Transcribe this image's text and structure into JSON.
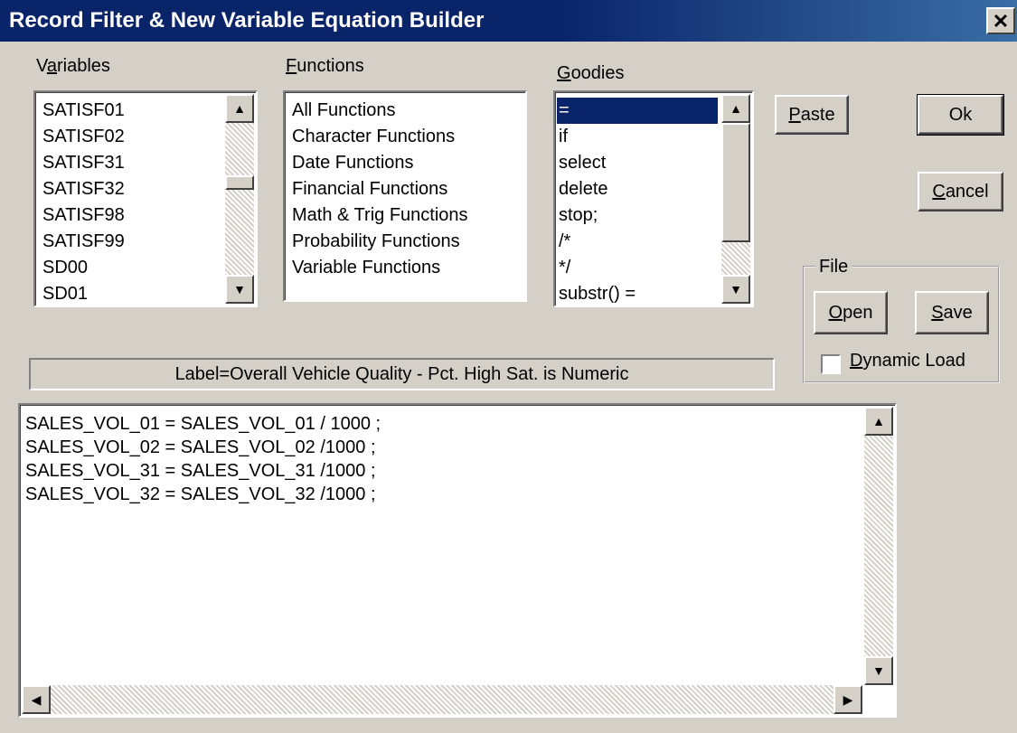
{
  "window": {
    "title": "Record Filter & New Variable Equation Builder",
    "close_label": "✕"
  },
  "variables": {
    "label_pre": "V",
    "label_ul": "a",
    "label_post": "riables",
    "items": [
      "SATISF01",
      "SATISF02",
      "SATISF31",
      "SATISF32",
      "SATISF98",
      "SATISF99",
      "SD00",
      "SD01"
    ]
  },
  "functions": {
    "label_ul": "F",
    "label_post": "unctions",
    "items": [
      "All Functions",
      "Character Functions",
      "Date Functions",
      "Financial Functions",
      "Math & Trig Functions",
      "Probability Functions",
      "Variable Functions"
    ]
  },
  "goodies": {
    "label_ul": "G",
    "label_post": "oodies",
    "items": [
      "=",
      "if",
      "select",
      "delete",
      "stop;",
      "/*",
      " */",
      "substr() ="
    ],
    "selected_index": 0
  },
  "buttons": {
    "paste_ul": "P",
    "paste_post": "aste",
    "ok": "Ok",
    "cancel_ul": "C",
    "cancel_post": "ancel",
    "open_ul": "O",
    "open_post": "pen",
    "save_ul": "S",
    "save_post": "ave"
  },
  "file_group": {
    "label": "File",
    "dynamic_load_ul": "D",
    "dynamic_load_post": "ynamic Load",
    "dynamic_load_checked": false
  },
  "status_text": "Label=Overall Vehicle Quality - Pct. High Sat. is Numeric",
  "editor": {
    "lines": [
      "SALES_VOL_01 = SALES_VOL_01 / 1000 ;",
      "SALES_VOL_02 = SALES_VOL_02 /1000 ;",
      "SALES_VOL_31 = SALES_VOL_31 /1000 ;",
      "SALES_VOL_32 = SALES_VOL_32 /1000 ;"
    ]
  },
  "icons": {
    "scroll_up": "▲",
    "scroll_down": "▼",
    "scroll_left": "◀",
    "scroll_right": "▶"
  }
}
